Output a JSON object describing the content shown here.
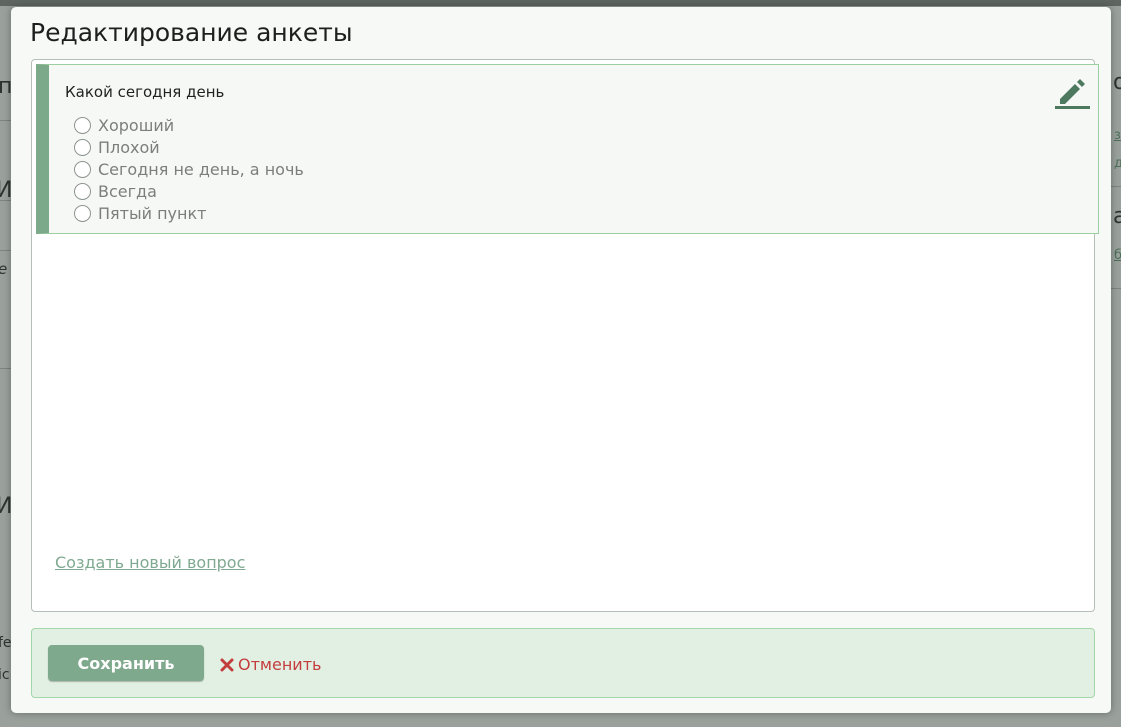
{
  "background": {
    "fragments": [
      "п",
      "И",
      "е",
      "И",
      "fe",
      "ic",
      "о",
      "а",
      "б",
      "з",
      "д"
    ]
  },
  "modal": {
    "title": "Редактирование анкеты",
    "question": {
      "title": "Какой сегодня день",
      "options": [
        {
          "label": "Хороший",
          "selected": false
        },
        {
          "label": "Плохой",
          "selected": false
        },
        {
          "label": "Сегодня не день, а ночь",
          "selected": false
        },
        {
          "label": "Всегда",
          "selected": false
        },
        {
          "label": "Пятый пункт",
          "selected": false
        }
      ],
      "edit_icon": "pencil-icon"
    },
    "create_question_link": "Создать новый вопрос",
    "footer": {
      "save_label": "Сохранить",
      "cancel_label": "Отменить",
      "cancel_icon": "close-icon"
    }
  },
  "colors": {
    "accent": "#7fa98d",
    "cancel": "#c43d3d",
    "card_border": "#9bcf9f",
    "footer_bg": "#e2efe3"
  }
}
